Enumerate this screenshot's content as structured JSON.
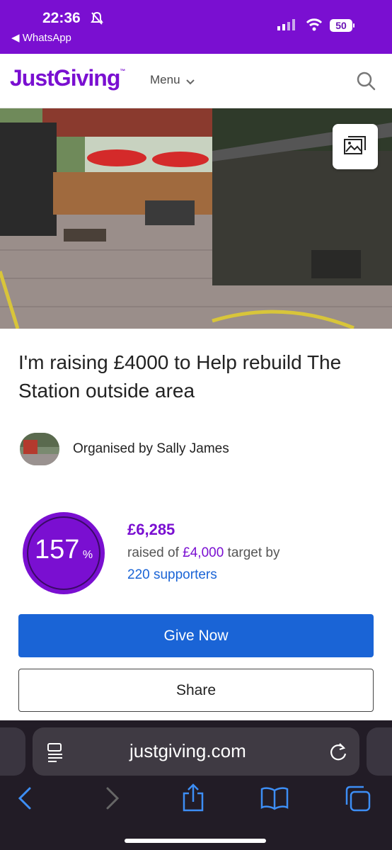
{
  "status_bar": {
    "time": "22:36",
    "back_label": "◀ WhatsApp",
    "battery": "50",
    "bg_color": "#7a0fd1"
  },
  "header": {
    "logo": "JustGiving",
    "logo_tm": "™",
    "menu_label": "Menu",
    "icons": [
      "chevron-down-icon",
      "search-icon"
    ]
  },
  "hero": {
    "gallery_icon": "image-gallery-icon"
  },
  "campaign": {
    "title": "I'm raising £4000 to Help rebuild The Station outside area",
    "organiser": "Organised by Sally James"
  },
  "progress": {
    "percent": "157",
    "percent_symbol": "%",
    "raised_amount": "£6,285",
    "raised_prefix": "raised of ",
    "target": "£4,000",
    "raised_suffix": " target by",
    "supporters": "220 supporters"
  },
  "actions": {
    "give": "Give Now",
    "share": "Share"
  },
  "browser": {
    "url": "justgiving.com",
    "icons": [
      "reader-icon",
      "reload-icon",
      "back-icon",
      "forward-icon",
      "share-icon",
      "bookmarks-icon",
      "tabs-icon"
    ]
  },
  "colors": {
    "brand_purple": "#7a0fd1",
    "action_blue": "#1a64d6"
  }
}
